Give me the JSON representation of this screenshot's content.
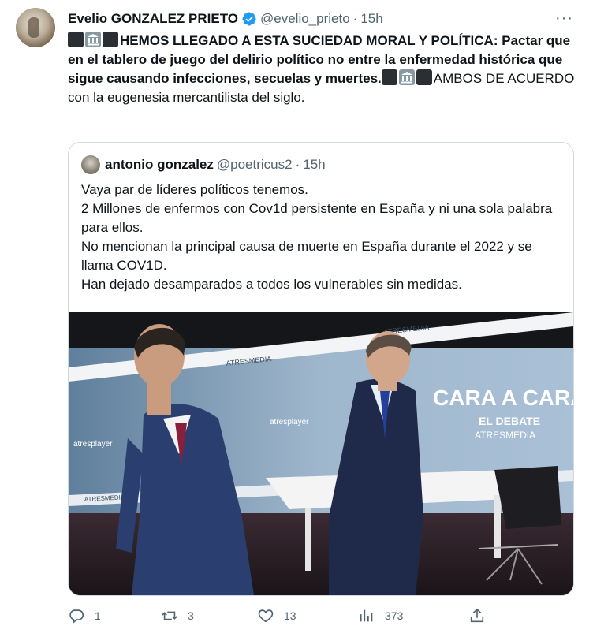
{
  "author": {
    "display_name": "Evelio GONZALEZ PRIETO",
    "handle": "@evelio_prieto",
    "separator": "·",
    "time": "15h"
  },
  "more_label": "···",
  "tweet_text": {
    "bold_part": "HEMOS LLEGADO A ESTA SUCIEDAD MORAL Y POLÍTICA: Pactar que en el tablero de juego del delirio político no entre la enfermedad histórica que sigue causando infecciones, secuelas y muertes.",
    "normal_part": "AMBOS DE ACUERDO con la eugenesia mercantilista del siglo."
  },
  "quoted": {
    "display_name": "antonio gonzalez",
    "handle": "@poetricus2",
    "separator": "·",
    "time": "15h",
    "lines": [
      "Vaya par de líderes políticos tenemos.",
      "2 Millones de enfermos con Cov1d persistente en España y ni una sola palabra para ellos.",
      "No mencionan la principal causa de muerte en España durante el 2022 y se llama COV1D.",
      "Han dejado desamparados a todos los vulnerables sin medidas."
    ],
    "photo": {
      "brand_text": "ATRESMEDIA",
      "title_text": "CARA A CARA",
      "subtitle_1": "EL DEBATE",
      "subtitle_2": "ATRESMEDIA",
      "player_text": "atresplayer"
    }
  },
  "actions": {
    "reply": {
      "icon": "reply-icon",
      "count": "1"
    },
    "retweet": {
      "icon": "retweet-icon",
      "count": "3"
    },
    "like": {
      "icon": "heart-icon",
      "count": "13"
    },
    "views": {
      "icon": "views-icon",
      "count": "373"
    },
    "share": {
      "icon": "share-icon"
    }
  },
  "colors": {
    "text": "#0f1419",
    "secondary": "#536471",
    "verified": "#1d9bf0",
    "border": "#cfd9de"
  }
}
